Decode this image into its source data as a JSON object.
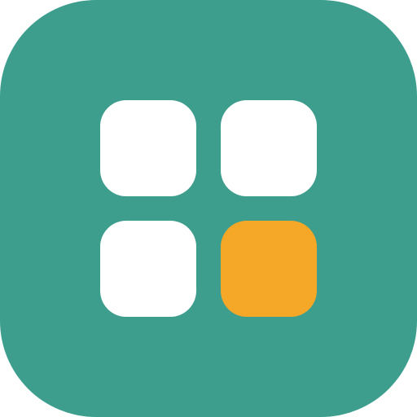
{
  "app_icon": {
    "icon_name": "app-grid-icon",
    "background_color": "#3d9e8e",
    "tiles": [
      {
        "position": "top-left",
        "color": "#ffffff"
      },
      {
        "position": "top-right",
        "color": "#ffffff"
      },
      {
        "position": "bottom-left",
        "color": "#ffffff"
      },
      {
        "position": "bottom-right",
        "color": "#f5a727"
      }
    ]
  }
}
